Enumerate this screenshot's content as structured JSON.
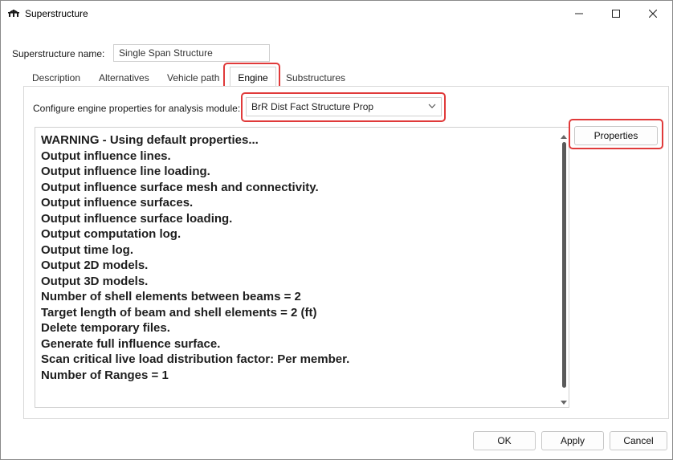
{
  "window": {
    "title": "Superstructure",
    "icon": "bridge-icon",
    "controls": {
      "minimize": "—",
      "maximize": "☐",
      "close": "✕"
    }
  },
  "superstructure_name": {
    "label": "Superstructure name:",
    "value": "Single Span Structure"
  },
  "tabs": [
    {
      "label": "Description",
      "active": false
    },
    {
      "label": "Alternatives",
      "active": false
    },
    {
      "label": "Vehicle path",
      "active": false
    },
    {
      "label": "Engine",
      "active": true
    },
    {
      "label": "Substructures",
      "active": false
    }
  ],
  "engine": {
    "configure_label": "Configure engine properties for analysis module:",
    "module_selected": "BrR Dist Fact Structure Prop",
    "properties_button": "Properties",
    "properties_lines": [
      "WARNING - Using default properties...",
      "Output influence lines.",
      "Output influence line loading.",
      "Output influence surface mesh and connectivity.",
      "Output influence surfaces.",
      "Output influence surface loading.",
      "Output computation log.",
      "Output time log.",
      "Output 2D models.",
      "Output 3D models.",
      "Number of shell elements between beams = 2",
      "Target length of beam and shell elements = 2 (ft)",
      "Delete temporary files.",
      "Generate full influence surface.",
      "Scan critical live load distribution factor: Per member.",
      "Number of Ranges = 1"
    ]
  },
  "footer": {
    "ok": "OK",
    "apply": "Apply",
    "cancel": "Cancel"
  },
  "colors": {
    "highlight": "#e03a3a",
    "scroll_thumb": "#5a5a5a"
  }
}
